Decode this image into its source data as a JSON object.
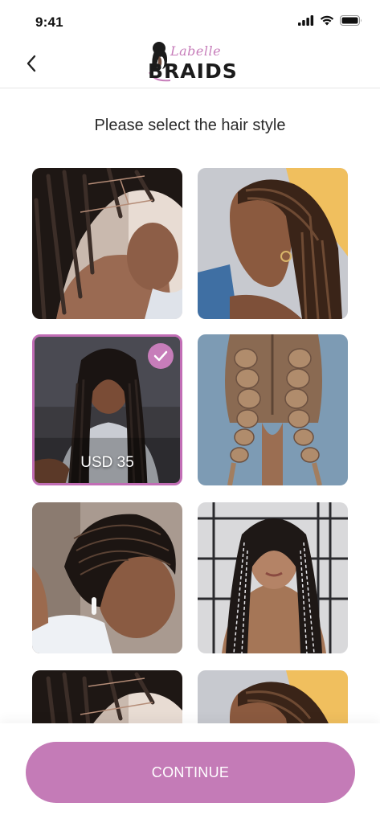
{
  "status_bar": {
    "time": "9:41",
    "icons": [
      "signal-icon",
      "wifi-icon",
      "battery-icon"
    ]
  },
  "header": {
    "back_icon": "chevron-left-icon",
    "logo": {
      "script_text": "Labelle",
      "main_text": "BRAIDS"
    }
  },
  "main": {
    "title": "Please select the hair style",
    "styles": [
      {
        "id": "box-braids-1",
        "selected": false,
        "price": ""
      },
      {
        "id": "cornrow-braids-1",
        "selected": false,
        "price": ""
      },
      {
        "id": "knotless-braids",
        "selected": true,
        "price": "USD 35"
      },
      {
        "id": "dutch-braids",
        "selected": false,
        "price": ""
      },
      {
        "id": "stitch-cornrows",
        "selected": false,
        "price": ""
      },
      {
        "id": "ribbon-box-braids",
        "selected": false,
        "price": ""
      },
      {
        "id": "box-braids-2",
        "selected": false,
        "price": ""
      },
      {
        "id": "cornrow-braids-2",
        "selected": false,
        "price": ""
      }
    ]
  },
  "footer": {
    "continue_label": "CONTINUE"
  },
  "colors": {
    "accent": "#c47bb7",
    "selected_border": "#c16db5",
    "text": "#2a2a2a"
  }
}
